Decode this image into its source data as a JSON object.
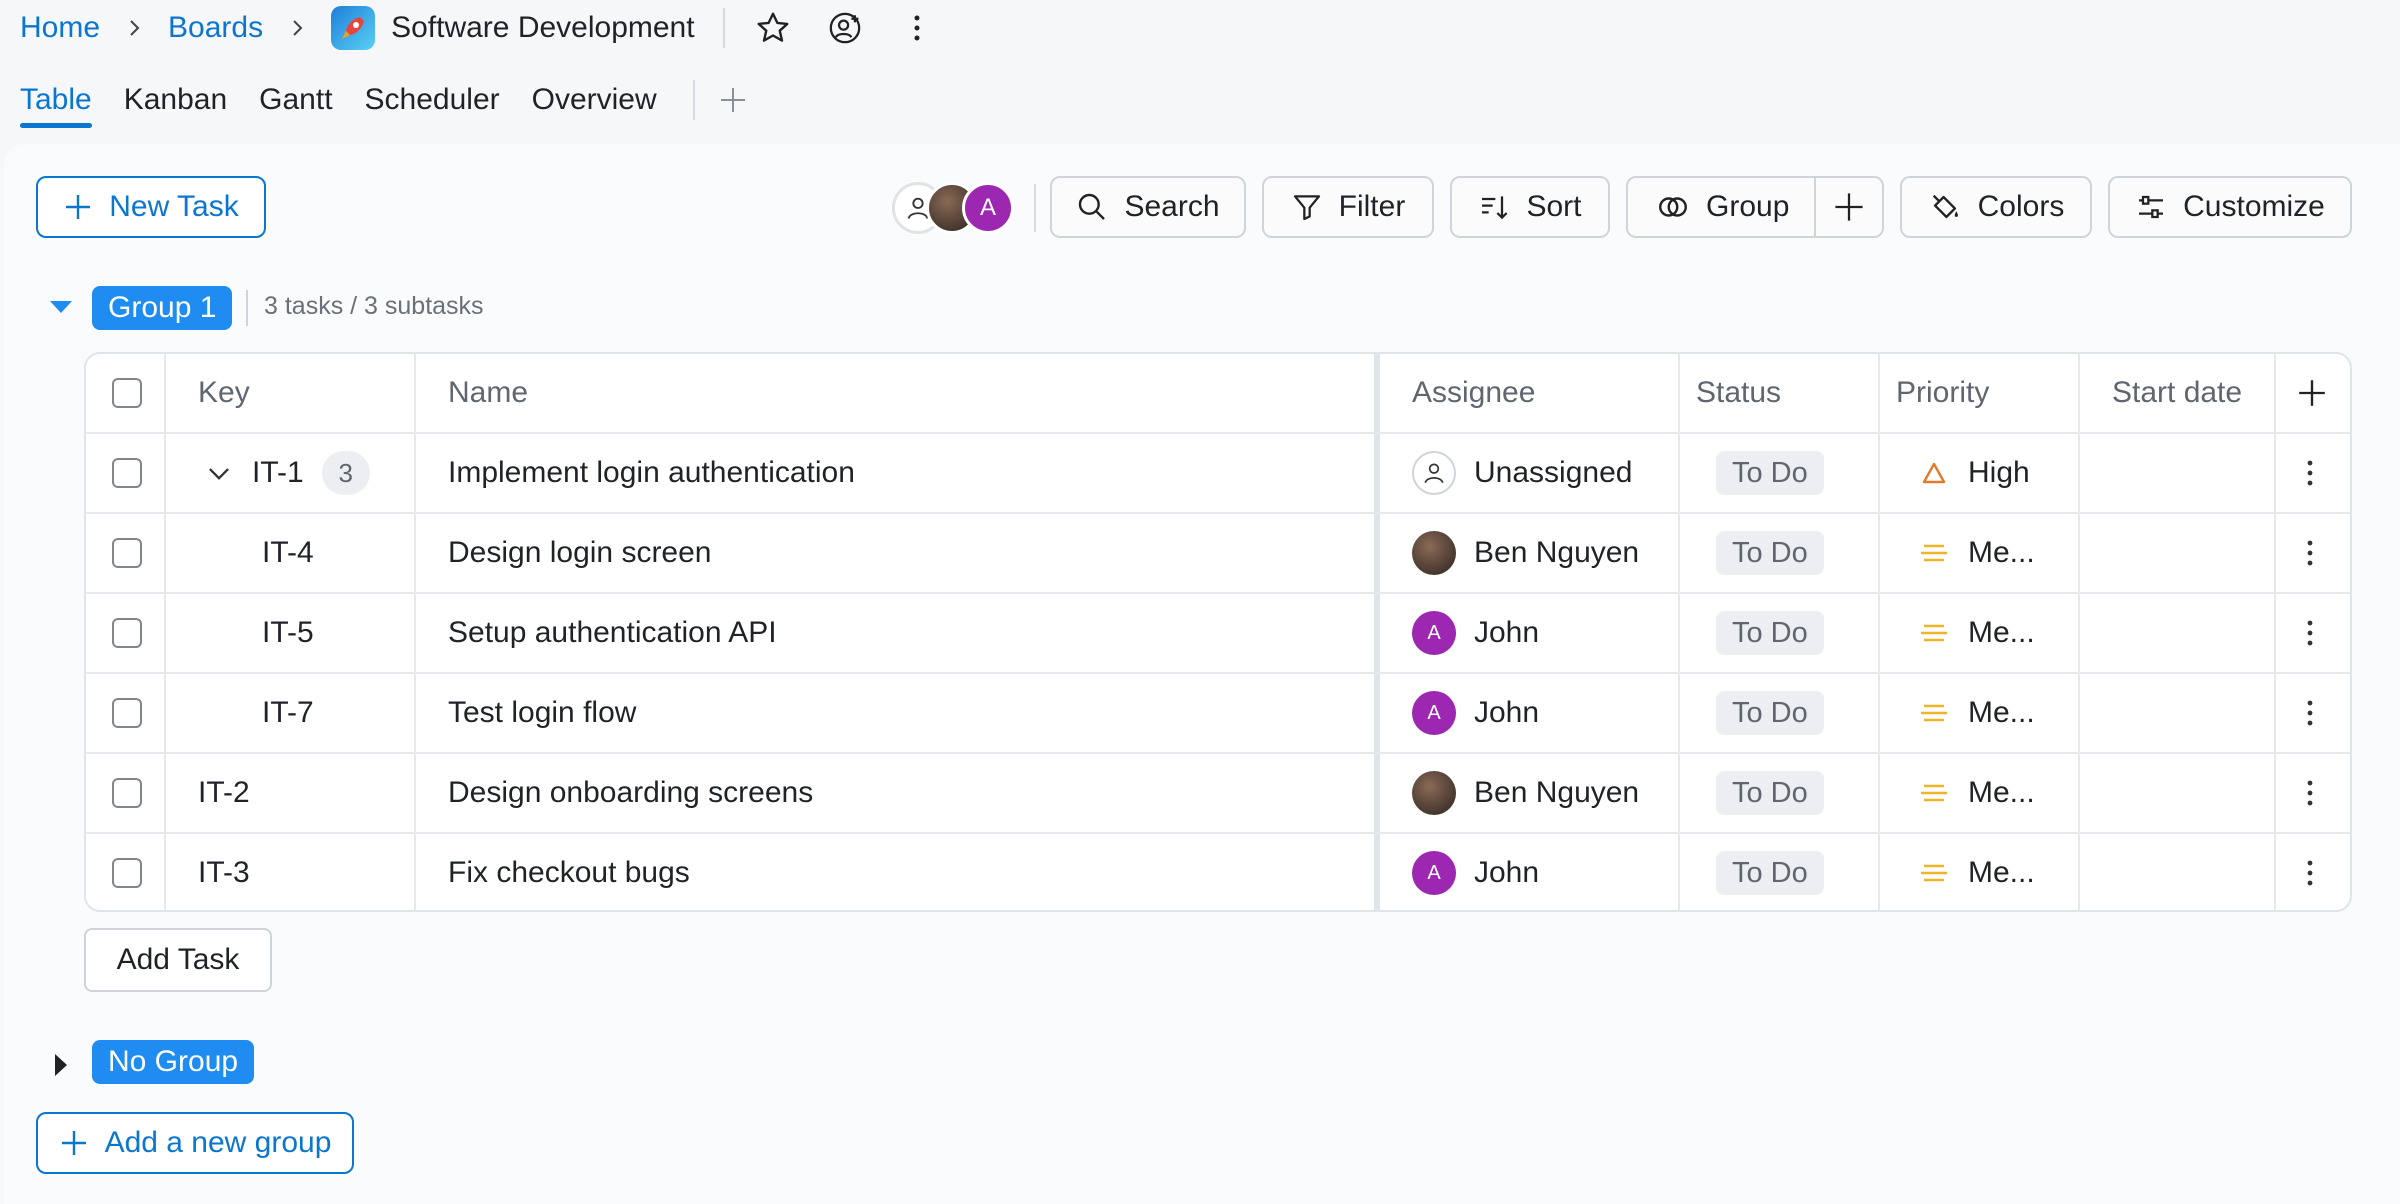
{
  "breadcrumb": {
    "home": "Home",
    "boards": "Boards",
    "board_name": "Software Development"
  },
  "tabs": [
    {
      "label": "Table",
      "active": true
    },
    {
      "label": "Kanban"
    },
    {
      "label": "Gantt"
    },
    {
      "label": "Scheduler"
    },
    {
      "label": "Overview"
    }
  ],
  "toolbar": {
    "new_task": "New Task",
    "avatar_letter": "A",
    "search": "Search",
    "filter": "Filter",
    "sort": "Sort",
    "group": "Group",
    "colors": "Colors",
    "customize": "Customize"
  },
  "groups": [
    {
      "name": "Group 1",
      "expanded": true,
      "count": "3 tasks / 3 subtasks"
    },
    {
      "name": "No Group",
      "expanded": false
    }
  ],
  "table": {
    "columns": [
      "Key",
      "Name",
      "Assignee",
      "Status",
      "Priority",
      "Start date"
    ],
    "rows": [
      {
        "key": "IT-1",
        "subtasks": "3",
        "name": "Implement login authentication",
        "assignee": "Unassigned",
        "status": "To Do",
        "priority": "High"
      },
      {
        "key": "IT-4",
        "name": "Design login screen",
        "assignee": "Ben Nguyen",
        "status": "To Do",
        "priority": "Me..."
      },
      {
        "key": "IT-5",
        "name": "Setup authentication API",
        "assignee": "John",
        "avatar_letter": "A",
        "status": "To Do",
        "priority": "Me..."
      },
      {
        "key": "IT-7",
        "name": "Test login flow",
        "assignee": "John",
        "avatar_letter": "A",
        "status": "To Do",
        "priority": "Me..."
      },
      {
        "key": "IT-2",
        "name": "Design onboarding screens",
        "assignee": "Ben Nguyen",
        "status": "To Do",
        "priority": "Me..."
      },
      {
        "key": "IT-3",
        "name": "Fix checkout bugs",
        "assignee": "John",
        "avatar_letter": "A",
        "status": "To Do",
        "priority": "Me..."
      }
    ]
  },
  "add_task": "Add Task",
  "add_group": "Add a new group",
  "colors": {
    "accent": "#0b76d0",
    "group_chip": "#1e8cf0",
    "avatar_purple": "#9c27b0",
    "priority_high": "#e07b2a",
    "priority_medium": "#f0b429"
  }
}
